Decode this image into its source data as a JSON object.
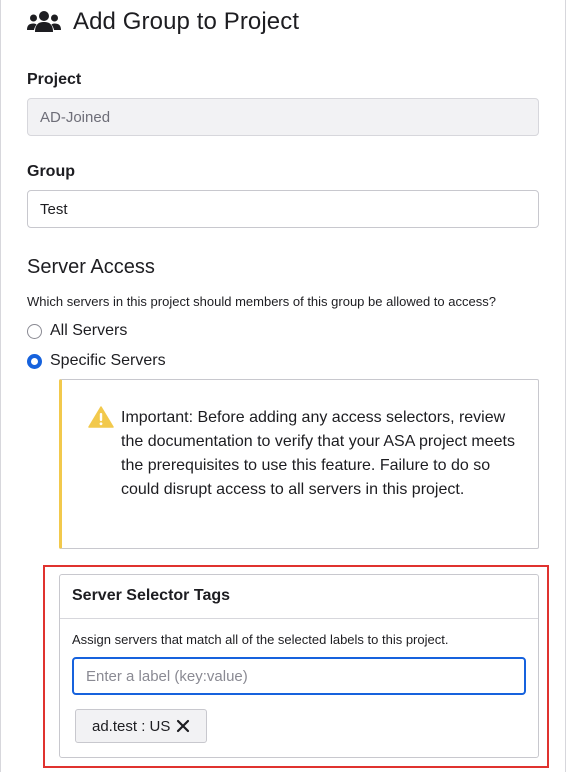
{
  "page": {
    "title": "Add Group to Project"
  },
  "project": {
    "label": "Project",
    "value": "AD-Joined"
  },
  "group": {
    "label": "Group",
    "value": "Test"
  },
  "server_access": {
    "title": "Server Access",
    "help": "Which servers in this project should members of this group be allowed to access?",
    "options": [
      {
        "label": "All Servers",
        "checked": false
      },
      {
        "label": "Specific Servers",
        "checked": true
      }
    ]
  },
  "callout": {
    "text": "Important: Before adding any access selectors, review the documentation to verify that your ASA project meets the prerequisites to use this feature. Failure to do so could disrupt access to all servers in this project."
  },
  "selector": {
    "title": "Server Selector Tags",
    "description": "Assign servers that match all of the selected labels to this project.",
    "placeholder": "Enter a label (key:value)",
    "tags": [
      {
        "label": "ad.test : US"
      }
    ]
  },
  "colors": {
    "accent": "#1662dd",
    "warning": "#f2c94c",
    "highlight": "#e0322f"
  }
}
